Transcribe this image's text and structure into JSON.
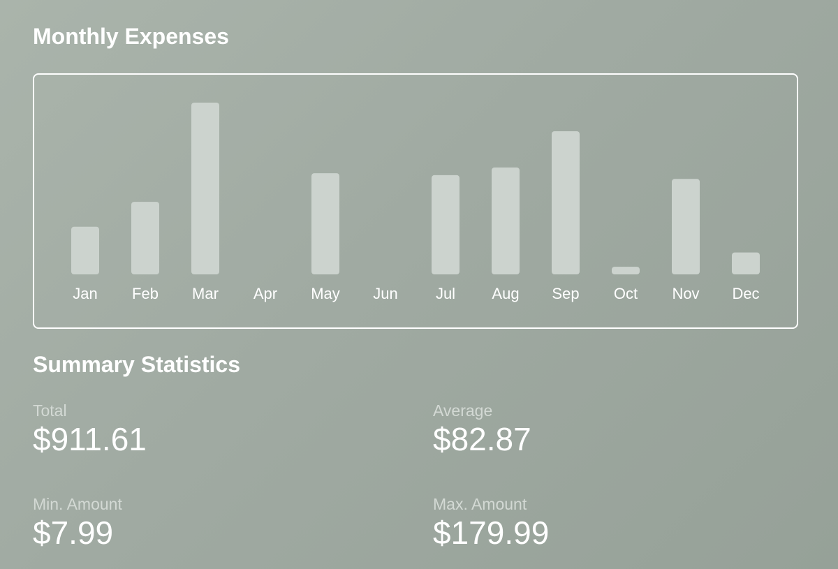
{
  "chart_data": {
    "type": "bar",
    "title": "Monthly Expenses",
    "categories": [
      "Jan",
      "Feb",
      "Mar",
      "Apr",
      "May",
      "Jun",
      "Jul",
      "Aug",
      "Sep",
      "Oct",
      "Nov",
      "Dec"
    ],
    "values": [
      50,
      76,
      179.99,
      0,
      106,
      0,
      104,
      112,
      149.99,
      7.99,
      100,
      23
    ],
    "xlabel": "",
    "ylabel": "",
    "ylim": [
      0,
      179.99
    ],
    "grid": false,
    "bar_color": "#ccd3ce"
  },
  "summary": {
    "title": "Summary Statistics",
    "total_label": "Total",
    "total_value": "$911.61",
    "average_label": "Average",
    "average_value": "$82.87",
    "min_label": "Min. Amount",
    "min_value": "$7.99",
    "max_label": "Max. Amount",
    "max_value": "$179.99"
  }
}
